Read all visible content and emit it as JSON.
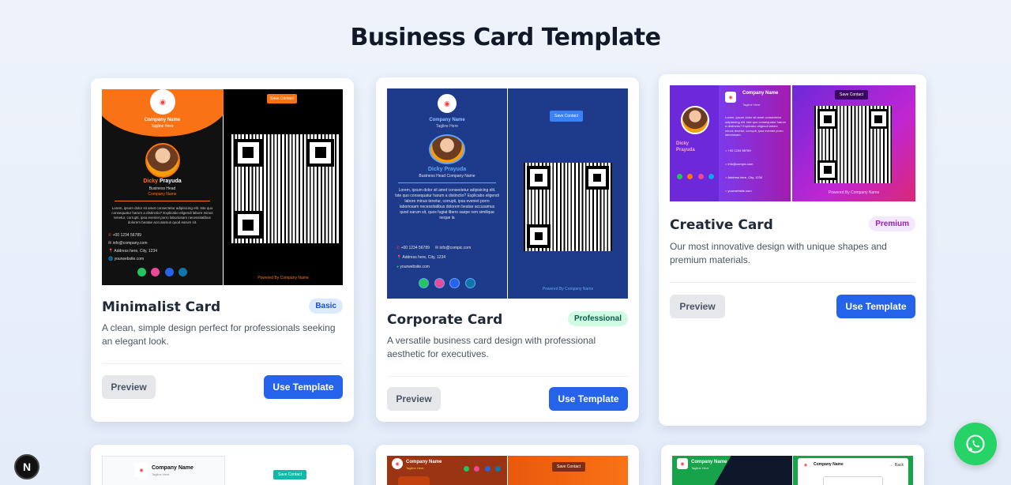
{
  "page": {
    "title": "Business Card Template"
  },
  "cards": [
    {
      "title": "Minimalist Card",
      "badge": "Basic",
      "description": "A clean, simple design perfect for professionals seeking an elegant look.",
      "preview_label": "Preview",
      "use_label": "Use Template",
      "front": {
        "company_name": "Company Name",
        "tagline": "Tagline Here",
        "person_first": "Dicky",
        "person_last": "Prayuda",
        "role": "Business Head",
        "company_small": "Company Name",
        "bio": "Lorem, ipsum dolor sit amet consectetur adipisicing elit. Iste quo consequatur harum a distinctio? Explicabo eligendi labore minus tenetur, corrupti, ipsa eveniet porro laboriosam necessitatibus dolorem beatae accusamus quod earum sit.",
        "phone": "+00 1234 56789",
        "email": "info@company.com",
        "address": "Address here, City, 1234",
        "website": "yourwebsite.com"
      },
      "back": {
        "save_label": "Save Contact",
        "powered": "Powered By Company Name"
      },
      "colors": {
        "front_top": "#f97316",
        "front_bg": "#111111",
        "accent": "#f97316"
      }
    },
    {
      "title": "Corporate Card",
      "badge": "Professional",
      "description": "A versatile business card design with professional aesthetic for executives.",
      "preview_label": "Preview",
      "use_label": "Use Template",
      "front": {
        "company_name": "Company Name",
        "tagline": "Tagline Here",
        "person_first": "Dicky",
        "person_last": "Prayuda",
        "role": "Business Head",
        "company_small": "Company Name",
        "bio": "Lorem, ipsum dolor sit amet consectetur adipisicing elit. Iste quo consequatur harum a distinctio? Explicabo eligendi labore minus tenetur, corrupti, ipsa eveniet porro laboriosam necessitatibus dolorem beatae accusamus quod earum sit, quos fugiat libero saepe rem similique neque la",
        "phone": "+00 1234 56789",
        "email": "info@compic.com",
        "address": "Address here, City, 1234",
        "website": "yourwebsite.com"
      },
      "back": {
        "save_label": "Save Contact",
        "powered": "Powered By Company Name"
      },
      "colors": {
        "front_bg": "#1e3a8a",
        "accent": "#3b82f6"
      }
    },
    {
      "title": "Creative Card",
      "badge": "Premium",
      "description": "Our most innovative design with unique shapes and premium materials.",
      "preview_label": "Preview",
      "use_label": "Use Template",
      "front": {
        "company_name": "Company Name",
        "tagline": "Tagline Here",
        "person_first": "Dicky",
        "person_last": "Prayuda",
        "bio": "Lorem, ipsum dolor sit amet consectetur adipisicing elit. Iste quo consequatur harum a distinctio? Explicabo eligendi labore minus tenetur, corrupti, ipsa eveniet porro laboriosam.",
        "phone": "+00 1234 56789",
        "email": "info@compic.com",
        "address": "Address here, City, 1234",
        "website": "yourwebsite.com"
      },
      "back": {
        "save_label": "Save Contact",
        "powered": "Powered By Company Name"
      },
      "colors": {
        "from": "#4c1d95",
        "to": "#db2777"
      }
    }
  ],
  "bottom_cards": [
    {
      "company_name": "Company Name",
      "tagline": "Tagline Here",
      "save_label": "Save Contact"
    },
    {
      "company_name": "Company Name",
      "tagline": "Tagline Here",
      "save_label": "Save Contact"
    },
    {
      "company_name": "Company Name",
      "tagline": "Tagline Here",
      "back_label": "← Back"
    }
  ],
  "fabs": {
    "whatsapp": "whatsapp-icon",
    "next": "N"
  }
}
